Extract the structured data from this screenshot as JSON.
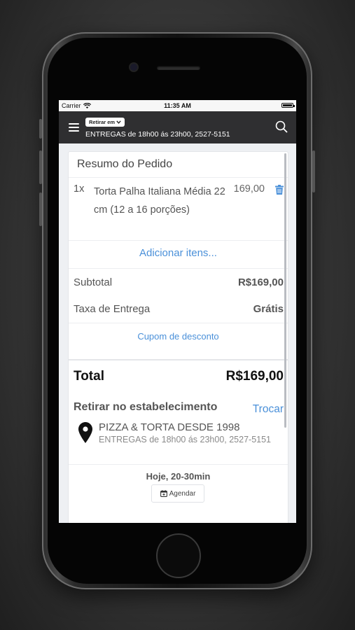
{
  "status_bar": {
    "carrier": "Carrier",
    "time": "11:35 AM"
  },
  "header": {
    "mode_label": "Retirar em",
    "subtitle": "ENTREGAS de 18h00 ás 23h00, 2527-5151"
  },
  "summary": {
    "title": "Resumo do Pedido",
    "items": [
      {
        "qty": "1x",
        "name": "Torta Palha Italiana Média 22 cm (12 a 16 porções)",
        "price": "169,00"
      }
    ],
    "add_items_label": "Adicionar itens...",
    "subtotal_label": "Subtotal",
    "subtotal_value": "R$169,00",
    "delivery_fee_label": "Taxa de Entrega",
    "delivery_fee_value": "Grátis",
    "coupon_label": "Cupom de desconto",
    "total_label": "Total",
    "total_value": "R$169,00"
  },
  "pickup": {
    "title": "Retirar no estabelecimento",
    "change_label": "Trocar",
    "store_name": "PIZZA & TORTA DESDE 1998",
    "store_hours": "ENTREGAS de 18h00 ás 23h00, 2527-5151",
    "time_estimate": "Hoje, 20-30min",
    "schedule_label": "Agendar"
  },
  "colors": {
    "accent": "#4a90d9",
    "navbar": "#2f2f31",
    "background": "#eef0f3"
  }
}
